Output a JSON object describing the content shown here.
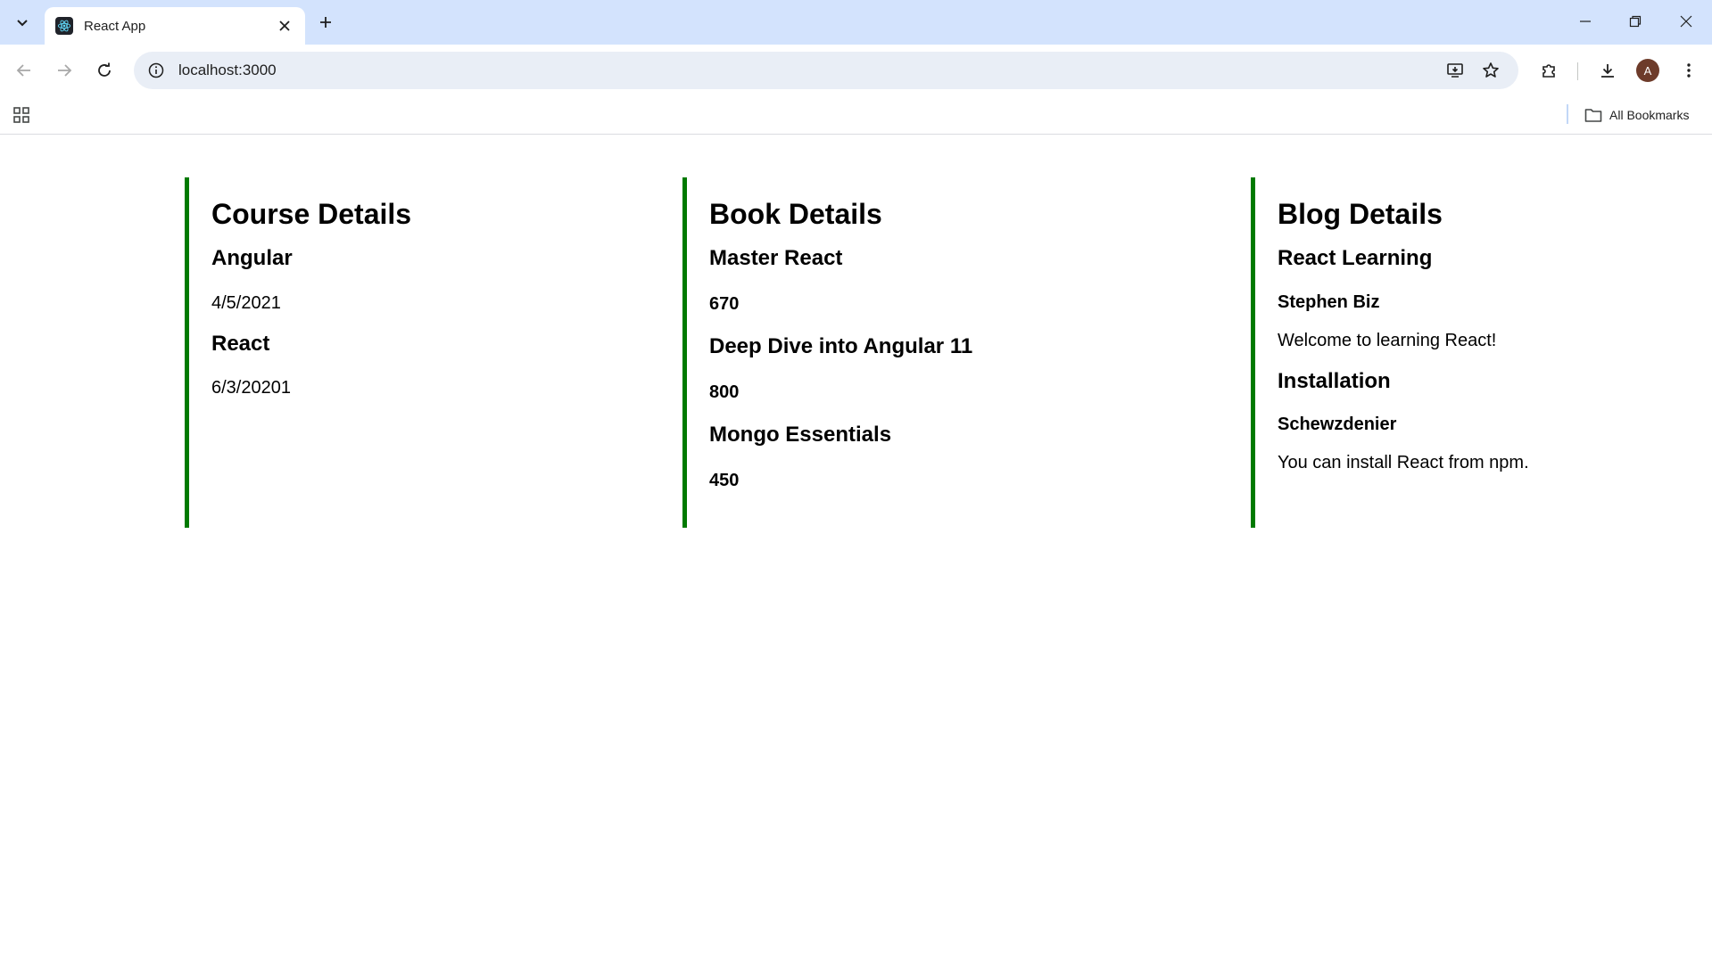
{
  "browser": {
    "tab_title": "React App",
    "url": "localhost:3000",
    "profile_initial": "A",
    "all_bookmarks_label": "All Bookmarks"
  },
  "page": {
    "course": {
      "heading": "Course Details",
      "items": [
        {
          "name": "Angular",
          "date": "4/5/2021"
        },
        {
          "name": "React",
          "date": "6/3/20201"
        }
      ]
    },
    "book": {
      "heading": "Book Details",
      "items": [
        {
          "name": "Master React",
          "price": "670"
        },
        {
          "name": "Deep Dive into Angular 11",
          "price": "800"
        },
        {
          "name": "Mongo Essentials",
          "price": "450"
        }
      ]
    },
    "blog": {
      "heading": "Blog Details",
      "items": [
        {
          "title": "React Learning",
          "author": "Stephen Biz",
          "content": "Welcome to learning React!"
        },
        {
          "title": "Installation",
          "author": "Schewzdenier",
          "content": "You can install React from npm."
        }
      ]
    },
    "accent_color": "#007a00"
  }
}
